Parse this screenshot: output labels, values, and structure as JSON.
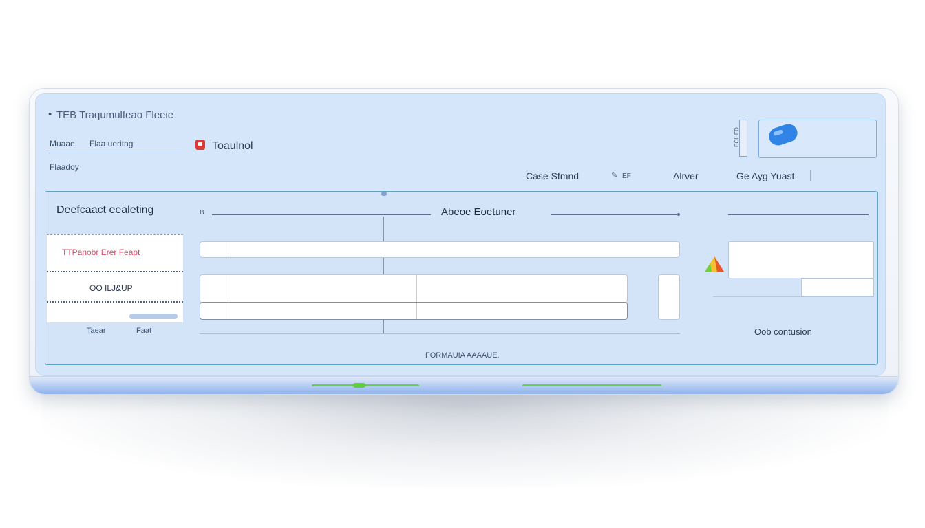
{
  "header": {
    "app_title": "TEB Traqumulfeao Fleeie",
    "field_label_1": "Muaae",
    "field_label_2": "Flaa ueritng",
    "sub_label": "Flaadoy",
    "tool_label": "Toaulnol"
  },
  "top_right": {
    "side_label": "ECILED"
  },
  "nav": {
    "item_1": "Case Sfmnd",
    "item_1_suffix": "EF",
    "item_2": "Alrver",
    "item_3": "Ge Ayg Yuast"
  },
  "panel": {
    "left_title": "Deefcaact eealeting",
    "card_top_text": "TTPanobr Erer Feapt",
    "card_mid_text": "OO ILJ&UP",
    "bottom_left_1": "Taear",
    "bottom_left_2": "Faat",
    "left_marker": "B",
    "center_title": "Abeoe Eoetuner",
    "footer_text": "FORMAUIA AAAAUE.",
    "right_label": "Oob contusion"
  },
  "colors": {
    "accent_blue": "#2f84e6",
    "panel_border": "#5fa4c9",
    "screen_bg": "#d6e6fa",
    "status_green": "#6ad04a",
    "icon_red": "#d93a36"
  },
  "icons": {
    "blue_button_icon": "toggle-icon",
    "warning_icon": "warning-icon",
    "tool_icon": "tool-icon"
  }
}
